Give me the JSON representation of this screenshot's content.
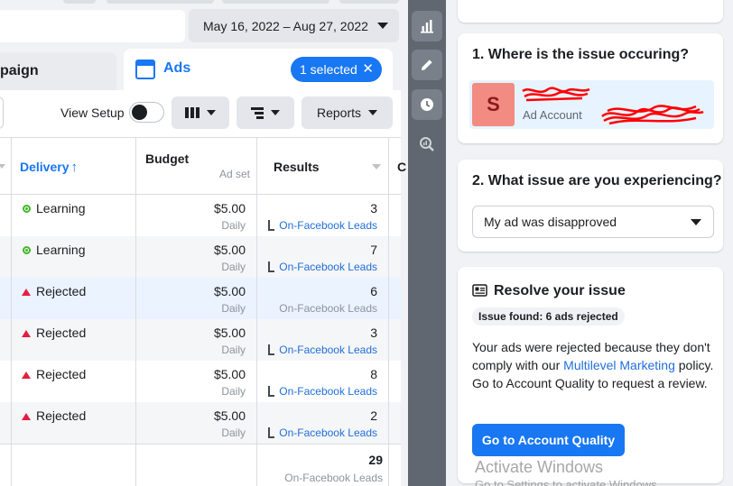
{
  "date_range": {
    "label": "May 16, 2022 – Aug 27, 2022"
  },
  "tabs": {
    "campaign_label": "paign",
    "ads_label": "Ads",
    "selected_label": "1 selected",
    "selected_close": "✕"
  },
  "toolbar": {
    "view_setup_label": "View Setup",
    "view_setup_enabled": false,
    "reports_label": "Reports"
  },
  "table": {
    "headers": {
      "delivery": "Delivery",
      "delivery_sort_glyph": "↑",
      "budget": "Budget",
      "budget_sub": "Ad set",
      "results": "Results",
      "cut_column": "C"
    },
    "rows": [
      {
        "status": "Learning",
        "status_type": "learning",
        "budget": "$5.00",
        "budget_period": "Daily",
        "result": "3",
        "result_type": "On-Facebook Leads",
        "result_linked": true
      },
      {
        "status": "Learning",
        "status_type": "learning",
        "budget": "$5.00",
        "budget_period": "Daily",
        "result": "7",
        "result_type": "On-Facebook Leads",
        "result_linked": true
      },
      {
        "status": "Rejected",
        "status_type": "rejected",
        "budget": "$5.00",
        "budget_period": "Daily",
        "result": "6",
        "result_type": "On-Facebook Leads",
        "result_linked": false
      },
      {
        "status": "Rejected",
        "status_type": "rejected",
        "budget": "$5.00",
        "budget_period": "Daily",
        "result": "3",
        "result_type": "On-Facebook Leads",
        "result_linked": true
      },
      {
        "status": "Rejected",
        "status_type": "rejected",
        "budget": "$5.00",
        "budget_period": "Daily",
        "result": "8",
        "result_type": "On-Facebook Leads",
        "result_linked": true
      },
      {
        "status": "Rejected",
        "status_type": "rejected",
        "budget": "$5.00",
        "budget_period": "Daily",
        "result": "2",
        "result_type": "On-Facebook Leads",
        "result_linked": true
      }
    ],
    "total": {
      "value": "29",
      "label": "On-Facebook Leads"
    }
  },
  "rail": {
    "items": [
      {
        "icon": "bar-chart-icon"
      },
      {
        "icon": "pencil-icon"
      },
      {
        "icon": "clock-icon"
      },
      {
        "icon": "inspect-icon"
      }
    ]
  },
  "help_panel": {
    "q1": {
      "title": "1. Where is the issue occuring?",
      "avatar_letter": "S",
      "account_sub": "Ad Account"
    },
    "q2": {
      "title": "2. What issue are you experiencing?",
      "selected": "My ad was disapproved"
    },
    "resolve": {
      "title": "Resolve your issue",
      "badge": "Issue found: 6 ads rejected",
      "body_1": "Your ads were rejected because they don't comply with our ",
      "body_link": "Multilevel Marketing",
      "body_2": " policy. Go to Account Quality to request a review.",
      "button": "Go to Account Quality"
    }
  },
  "watermark": {
    "line1": "Activate Windows",
    "line2": "Go to Settings to activate Windows."
  },
  "colors": {
    "accent": "#1877f2",
    "learning": "#42b72a",
    "rejected": "#e41e3f",
    "link": "#216fdb",
    "rail": "#606770",
    "redaction": "#ff0000"
  }
}
